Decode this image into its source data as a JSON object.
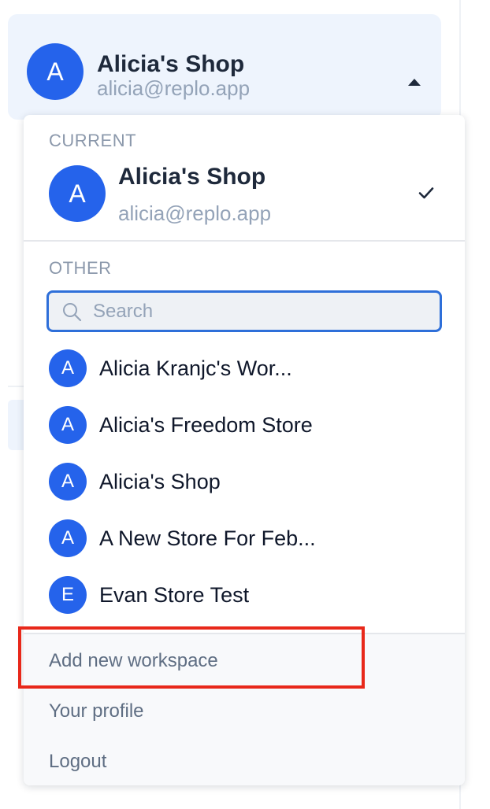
{
  "workspace_switcher": {
    "avatar_letter": "A",
    "name": "Alicia's Shop",
    "email": "alicia@replo.app",
    "caret_icon": "caret-up-icon"
  },
  "dropdown": {
    "current": {
      "section_label": "CURRENT",
      "avatar_letter": "A",
      "name": "Alicia's Shop",
      "email": "alicia@replo.app",
      "check_icon": "check-icon"
    },
    "other": {
      "section_label": "OTHER",
      "search": {
        "placeholder": "Search",
        "value": ""
      },
      "items": [
        {
          "avatar_letter": "A",
          "name": "Alicia Kranjc's Wor..."
        },
        {
          "avatar_letter": "A",
          "name": "Alicia's Freedom Store"
        },
        {
          "avatar_letter": "A",
          "name": "Alicia's Shop"
        },
        {
          "avatar_letter": "A",
          "name": "A New Store For Feb..."
        },
        {
          "avatar_letter": "E",
          "name": "Evan Store Test"
        }
      ]
    },
    "footer": {
      "add_workspace": "Add new workspace",
      "profile": "Your profile",
      "logout": "Logout"
    }
  },
  "colors": {
    "accent": "#2563eb",
    "highlight": "#e8281a",
    "switcher_bg": "#eef4fd"
  }
}
